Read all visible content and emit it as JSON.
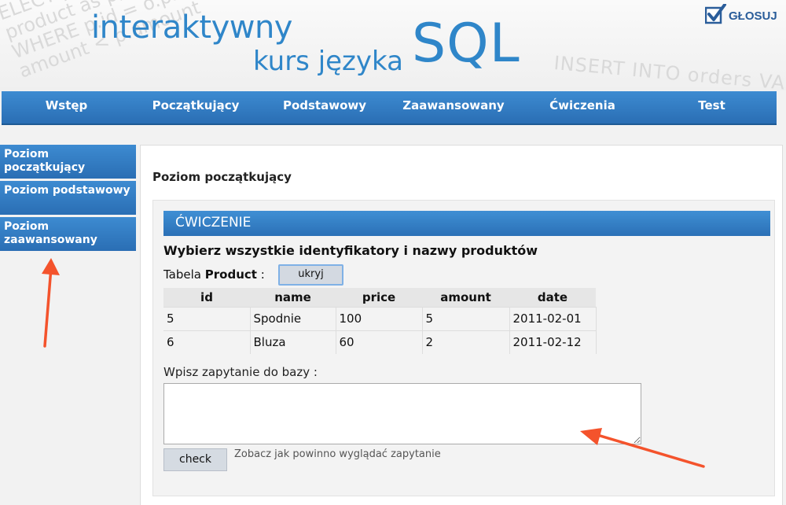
{
  "header": {
    "bg_code_left": [
      "ELECT p.id, p.",
      "product as p, or",
      "WHERE p.id = o.prod",
      "amount < p.amount"
    ],
    "bg_code_right": "INSERT INTO orders VA",
    "logo_line1": "interaktywny",
    "logo_line2": "kurs języka",
    "logo_sql": "SQL",
    "vote_label": "GŁOSUJ"
  },
  "nav": {
    "items": [
      {
        "label": "Wstęp"
      },
      {
        "label": "Początkujący"
      },
      {
        "label": "Podstawowy"
      },
      {
        "label": "Zaawansowany"
      },
      {
        "label": "Ćwiczenia"
      },
      {
        "label": "Test"
      }
    ]
  },
  "sidebar": {
    "items": [
      {
        "label": "Poziom początkujący"
      },
      {
        "label": "Poziom podstawowy"
      },
      {
        "label": "Poziom zaawansowany"
      }
    ]
  },
  "main": {
    "title": "Poziom początkujący",
    "exercise_header": "ĆWICZENIE",
    "task": "Wybierz wszystkie identyfikatory i nazwy produktów",
    "table_label_prefix": "Tabela",
    "table_name": "Product",
    "table_label_suffix": ":",
    "hide_button": "ukryj",
    "table": {
      "columns": [
        "id",
        "name",
        "price",
        "amount",
        "date"
      ],
      "rows": [
        [
          "5",
          "Spodnie",
          "100",
          "5",
          "2011-02-01"
        ],
        [
          "6",
          "Bluza",
          "60",
          "2",
          "2011-02-12"
        ]
      ]
    },
    "query_label": "Wpisz zapytanie do bazy :",
    "query_value": "",
    "check_button": "check",
    "show_query_link": "Zobacz jak powinno wyglądać zapytanie"
  },
  "colors": {
    "brand_blue": "#2f86c9",
    "nav_blue": "#2a6eb4",
    "annotation_arrow": "#f4532c"
  },
  "icons": {
    "vote": "checkbox-check-icon"
  }
}
